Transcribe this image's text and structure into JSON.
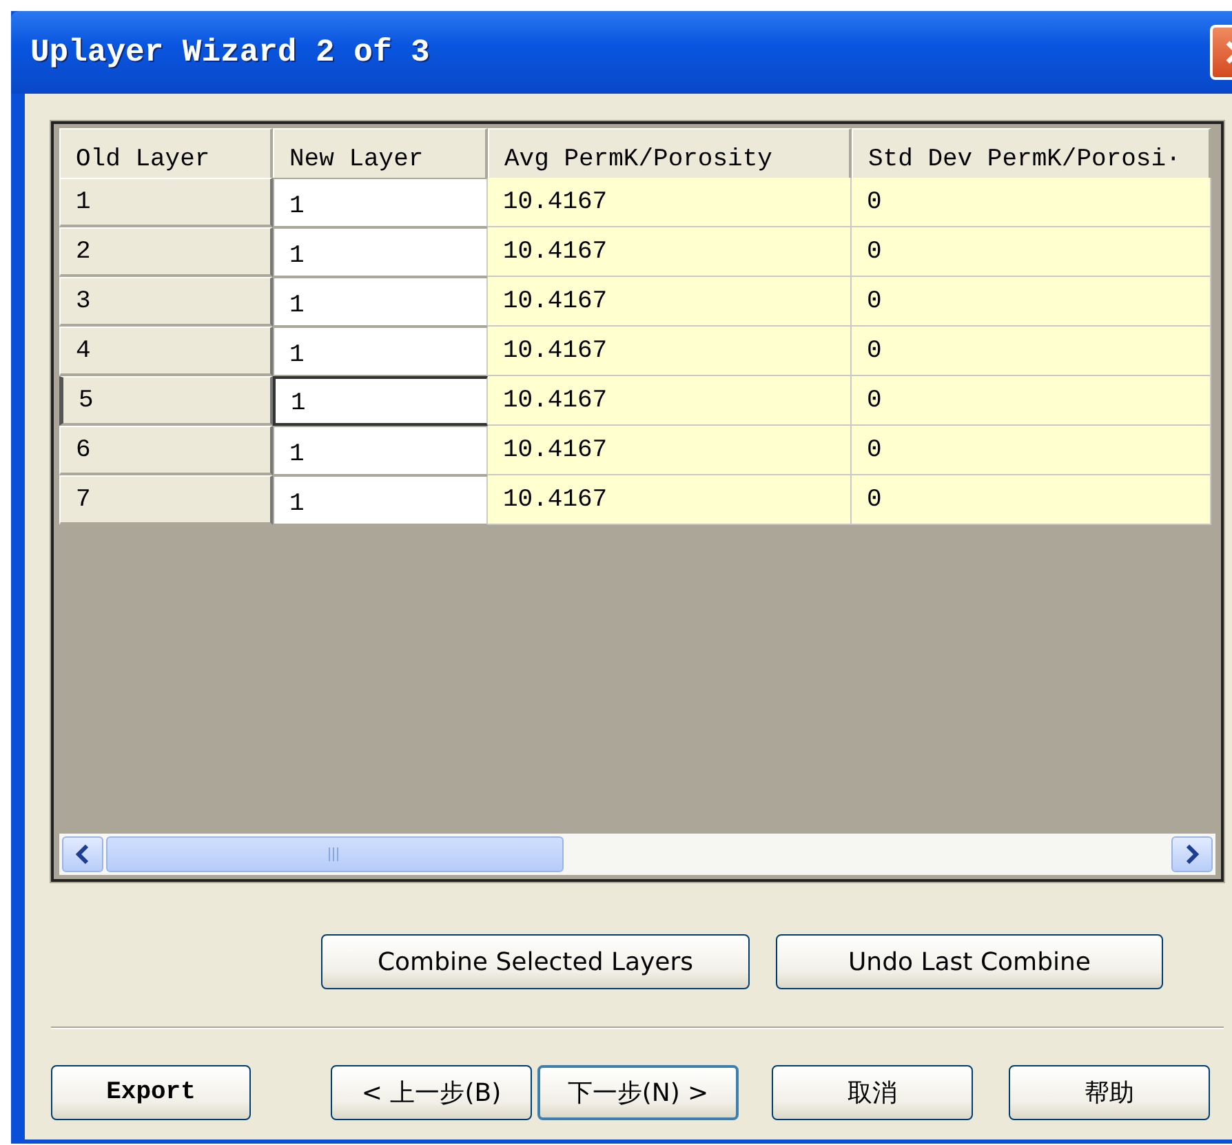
{
  "window": {
    "title": "Uplayer Wizard 2 of 3"
  },
  "table": {
    "columns": [
      "Old Layer",
      "New Layer",
      "Avg PermK/Porosity",
      "Std Dev PermK/Porosi·"
    ],
    "rows": [
      {
        "old": "1",
        "new": "1",
        "avg": "10.4167",
        "std": "0",
        "selected": false
      },
      {
        "old": "2",
        "new": "1",
        "avg": "10.4167",
        "std": "0",
        "selected": false
      },
      {
        "old": "3",
        "new": "1",
        "avg": "10.4167",
        "std": "0",
        "selected": false
      },
      {
        "old": "4",
        "new": "1",
        "avg": "10.4167",
        "std": "0",
        "selected": false
      },
      {
        "old": "5",
        "new": "1",
        "avg": "10.4167",
        "std": "0",
        "selected": true
      },
      {
        "old": "6",
        "new": "1",
        "avg": "10.4167",
        "std": "0",
        "selected": false
      },
      {
        "old": "7",
        "new": "1",
        "avg": "10.4167",
        "std": "0",
        "selected": false
      }
    ]
  },
  "actions": [
    "Combine Selected Layers",
    "Undo Last Combine"
  ],
  "footer": {
    "export": "Export",
    "buttons": [
      {
        "label": "< 上一步(B)",
        "default": false
      },
      {
        "label": "下一步(N) >",
        "default": true
      },
      {
        "label": "取消",
        "default": false
      },
      {
        "label": "帮助",
        "default": false
      }
    ]
  }
}
